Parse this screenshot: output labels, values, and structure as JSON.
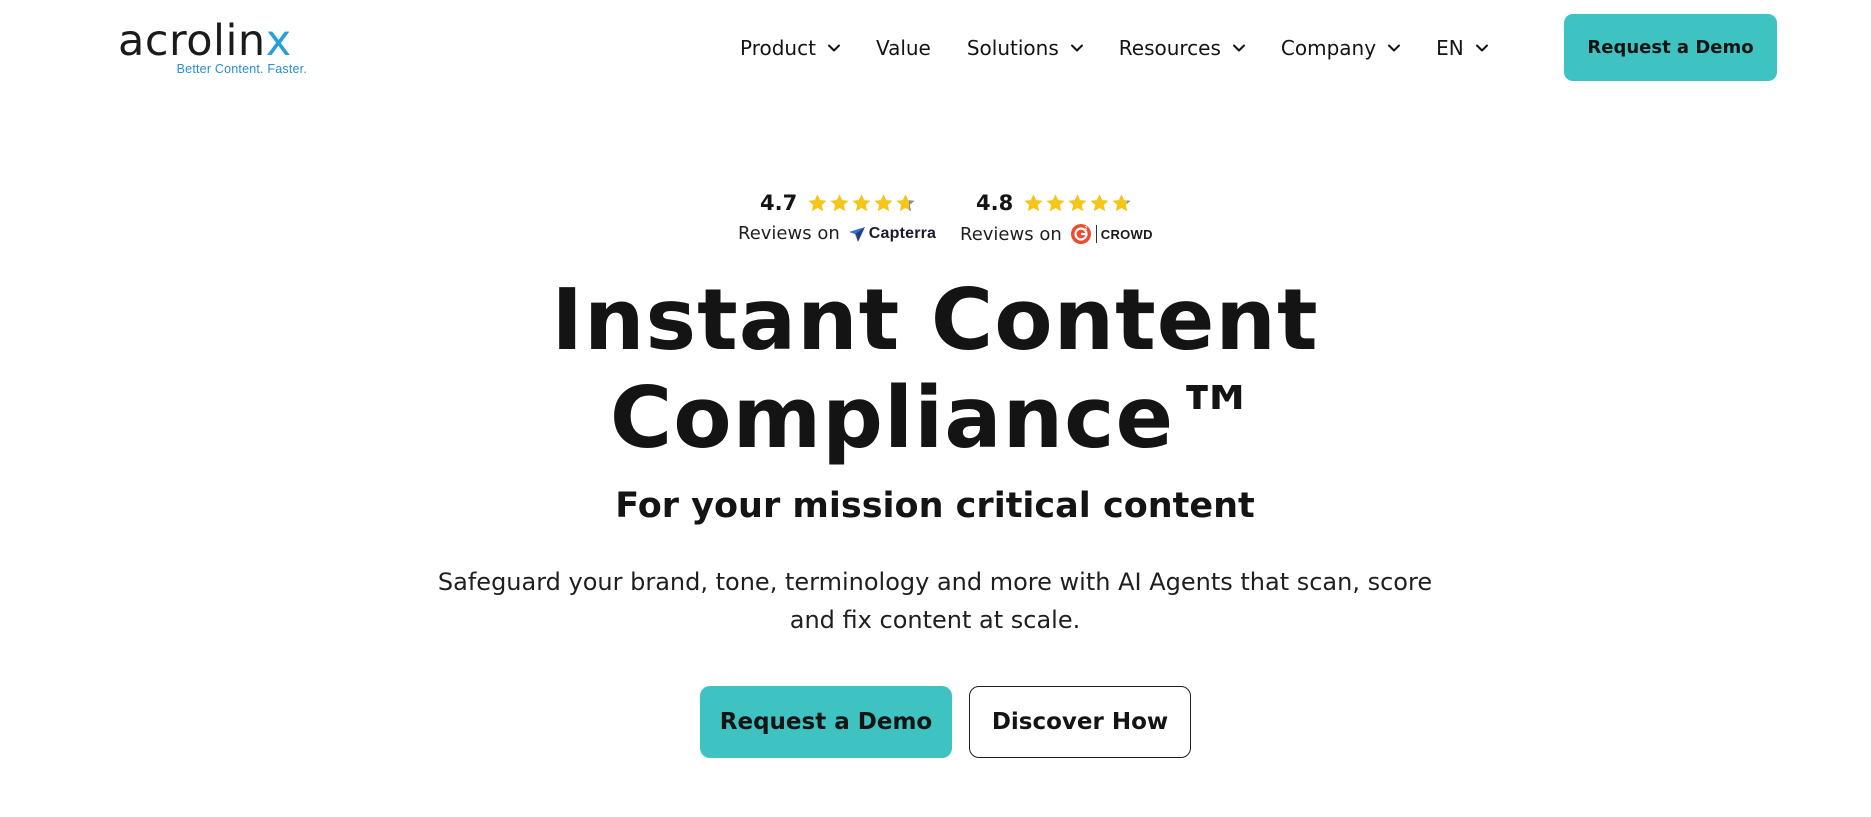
{
  "header": {
    "logo": {
      "wordmark_main": "acrolin",
      "wordmark_x": "x",
      "tagline": "Better Content. Faster."
    },
    "nav": [
      {
        "label": "Product",
        "has_dropdown": true
      },
      {
        "label": "Value",
        "has_dropdown": false
      },
      {
        "label": "Solutions",
        "has_dropdown": true
      },
      {
        "label": "Resources",
        "has_dropdown": true
      },
      {
        "label": "Company",
        "has_dropdown": true
      },
      {
        "label": "EN",
        "has_dropdown": true
      }
    ],
    "demo_button_label": "Request a Demo"
  },
  "ratings": [
    {
      "score": "4.7",
      "stars": 4.7,
      "reviews_on": "Reviews on",
      "brand": "Capterra",
      "brand_icon": "capterra-icon"
    },
    {
      "score": "4.8",
      "stars": 4.8,
      "reviews_on": "Reviews on",
      "brand": "CROWD",
      "brand_badge": "G2",
      "brand_icon": "g2-icon"
    }
  ],
  "hero": {
    "title_line1": "Instant Content",
    "title_line2": "Compliance™",
    "subtitle": "For your mission critical content",
    "description_line1": "Safeguard your brand, tone, terminology and more with AI Agents that scan, score",
    "description_line2": "and fix content at scale.",
    "primary_cta": "Request a Demo",
    "secondary_cta": "Discover How"
  },
  "colors": {
    "accent": "#3ec2c2",
    "text": "#141414",
    "logo_x": "#2a9fd6",
    "tagline": "#2a8fd0",
    "star": "#f5c518",
    "star_empty": "#8a9099",
    "capterra_blue": "#2f6fd8",
    "g2_red": "#ef4b2d"
  }
}
